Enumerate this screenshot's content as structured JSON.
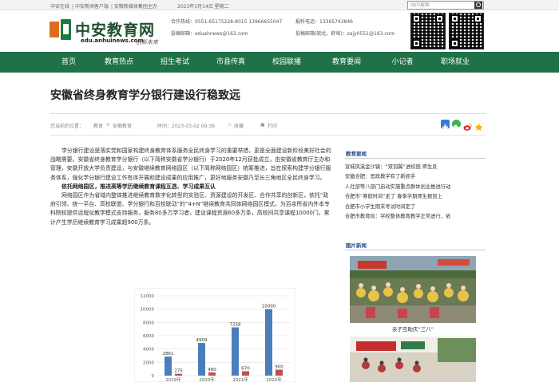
{
  "topbar": {
    "links": [
      "中安在线",
      "中安新闻客户端",
      "安徽新媒体集团主办"
    ],
    "date": "2023年3月14日 星期二",
    "right_links": [
      "",
      ""
    ],
    "search_placeholder": "站内搜索"
  },
  "header": {
    "logo_text": "中安教育网",
    "logo_domain": "edu.anhuinews.com",
    "slogan": "创新未来",
    "contact": {
      "phone_label": "合作热线：0551-65175228-8015 13966655047",
      "wechat_label": "投稿邮箱：eduahnews@163.com",
      "reporter_label": "报料电话：13365743846",
      "email_label": "投稿邮箱(皖北、蚌埠)：zajy0551@163.com"
    }
  },
  "nav": {
    "items": [
      "首页",
      "教育热点",
      "招生考试",
      "市县传真",
      "校园联播",
      "教育要闻",
      "小记者",
      "职场就业"
    ]
  },
  "article": {
    "title": "安徽省终身教育学分银行建设行稳致远",
    "location_label": "您当前的位置：",
    "breadcrumb": [
      "教育",
      "安徽教育"
    ],
    "time_label": "时间：2023-03-02 09:36",
    "favorite_label": "收藏",
    "print_label": "打印",
    "paragraphs": [
      "学分银行建设是落实党和国家构建终身教育体系服务全民终身学习的重要举措，更是全面建设新阶段美好社会的战略需要。安徽省终身教育学分银行（以下简称安徽省学分银行）于2020年12月获批成立，由安徽省教育厅主办和管理，安徽开放大学负责建设，与安徽继续教育网络园区（以下简称网络园区）统筹推进，旨在探索构建学分银行服务体系，强化学分银行建设工作有序开展和建设成果的应用推广，更好地服务安徽乃至长三角地区全民终身学习。",
      "依托网络园区，推进高等学历继续教育课程互选、学习成果互认",
      "网络园区作为省域内整体推进继续教育数字化转型的实验区、资源建设的开发区、合作共享的创新区，依托“政府引领、统一平台、高校联盟、学分银行和百校联动”的“4+N”继续教育共同体网络园区模式，为百余所省内外本专科院校提供远程化教学模式支持服务，服务80多万学习者，建设课程资源60多万条，高校间共享课程10000门，累计产生学历继续教育学习成果超900万条。"
    ]
  },
  "chart_data": {
    "type": "bar",
    "categories": [
      "2019年",
      "2020年",
      "2021年",
      "2022年"
    ],
    "series": [
      {
        "name": "",
        "values": [
          2861,
          4909,
          7258,
          10000
        ],
        "color": "#4a7ebb"
      },
      {
        "name": "",
        "values": [
          275,
          480,
          670,
          900
        ],
        "color": "#c0504d"
      }
    ],
    "ylim": [
      0,
      12000
    ],
    "yticks": [
      0,
      2000,
      4000,
      6000,
      8000,
      10000,
      12000
    ],
    "grid": true
  },
  "sidebar": {
    "news_heading": "教育要闻",
    "news_items": [
      "宣城凤溪金沙镇：“双羽翼”进校园 师生反",
      "安徽合肥：思政教学有了新抓手",
      "人社部等八部门启动实施重点群体创业推进行动",
      "合肥市“寒假时间”走了 春季学期师生报到上",
      "合肥市小学生期末考试时间定了",
      "合肥市教育局：学校整体教育教学正常进行，依"
    ],
    "photo_heading": "图片新闻",
    "photo1_caption": "亲子互助庆“三八”"
  },
  "colors": {
    "nav_bg": "#1f7148",
    "nav_active": "#165a38",
    "sidebar_heading": "#2b4a86",
    "logo_green": "#1d7a3e",
    "logo_orange": "#e06b1f"
  },
  "icons": [
    "search-icon",
    "favorite-icon",
    "print-icon",
    "share-add-icon",
    "wechat-icon",
    "weibo-icon",
    "star-icon"
  ]
}
